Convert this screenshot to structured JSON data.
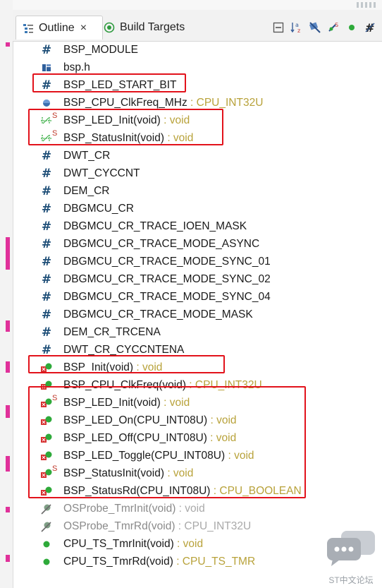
{
  "tabs": {
    "outline": {
      "label": "Outline",
      "close": "×"
    },
    "build_targets": {
      "label": "Build Targets"
    }
  },
  "toolbar_icons": [
    "collapse-all-icon",
    "sort-alphabetically-icon",
    "hide-fields-icon",
    "hide-static-members-icon",
    "hide-non-public-icon",
    "hide-macros-icon"
  ],
  "outline": {
    "items": [
      {
        "kind": "macro",
        "name": "BSP_MODULE",
        "type": ""
      },
      {
        "kind": "include",
        "name": "bsp.h",
        "type": ""
      },
      {
        "kind": "macro",
        "name": "BSP_LED_START_BIT",
        "type": ""
      },
      {
        "kind": "variable",
        "name": "BSP_CPU_ClkFreq_MHz",
        "type": " : CPU_INT32U"
      },
      {
        "kind": "proto-static",
        "name": "BSP_LED_Init(void)",
        "type": " : void",
        "static": "S"
      },
      {
        "kind": "proto-static",
        "name": "BSP_StatusInit(void)",
        "type": " : void",
        "static": "S"
      },
      {
        "kind": "macro",
        "name": "DWT_CR",
        "type": ""
      },
      {
        "kind": "macro",
        "name": "DWT_CYCCNT",
        "type": ""
      },
      {
        "kind": "macro",
        "name": "DEM_CR",
        "type": ""
      },
      {
        "kind": "macro",
        "name": "DBGMCU_CR",
        "type": ""
      },
      {
        "kind": "macro",
        "name": "DBGMCU_CR_TRACE_IOEN_MASK",
        "type": ""
      },
      {
        "kind": "macro",
        "name": "DBGMCU_CR_TRACE_MODE_ASYNC",
        "type": ""
      },
      {
        "kind": "macro",
        "name": "DBGMCU_CR_TRACE_MODE_SYNC_01",
        "type": ""
      },
      {
        "kind": "macro",
        "name": "DBGMCU_CR_TRACE_MODE_SYNC_02",
        "type": ""
      },
      {
        "kind": "macro",
        "name": "DBGMCU_CR_TRACE_MODE_SYNC_04",
        "type": ""
      },
      {
        "kind": "macro",
        "name": "DBGMCU_CR_TRACE_MODE_MASK",
        "type": ""
      },
      {
        "kind": "macro",
        "name": "DEM_CR_TRCENA",
        "type": ""
      },
      {
        "kind": "macro",
        "name": "DWT_CR_CYCCNTENA",
        "type": ""
      },
      {
        "kind": "function",
        "name": "BSP_Init(void)",
        "type": " : void"
      },
      {
        "kind": "function",
        "name": "BSP_CPU_ClkFreq(void)",
        "type": " : CPU_INT32U"
      },
      {
        "kind": "function-static",
        "name": "BSP_LED_Init(void)",
        "type": " : void",
        "static": "S"
      },
      {
        "kind": "function",
        "name": "BSP_LED_On(CPU_INT08U)",
        "type": " : void"
      },
      {
        "kind": "function",
        "name": "BSP_LED_Off(CPU_INT08U)",
        "type": " : void"
      },
      {
        "kind": "function",
        "name": "BSP_LED_Toggle(CPU_INT08U)",
        "type": " : void"
      },
      {
        "kind": "function-static",
        "name": "BSP_StatusInit(void)",
        "type": " : void",
        "static": "S"
      },
      {
        "kind": "function",
        "name": "BSP_StatusRd(CPU_INT08U)",
        "type": " : CPU_BOOLEAN"
      },
      {
        "kind": "function-disabled",
        "name": "OSProbe_TmrInit(void)",
        "type": " : void"
      },
      {
        "kind": "function-disabled",
        "name": "OSProbe_TmrRd(void)",
        "type": " : CPU_INT32U"
      },
      {
        "kind": "function-public",
        "name": "CPU_TS_TmrInit(void)",
        "type": " : void"
      },
      {
        "kind": "function-public",
        "name": "CPU_TS_TmrRd(void)",
        "type": " : CPU_TS_TMR"
      }
    ]
  },
  "watermark": {
    "label": "ST中文论坛"
  },
  "colors": {
    "highlight": "#e2121b",
    "type_text": "#b8a23a",
    "macro_icon": "#1f4f78",
    "public_fn": "#2eaa3a",
    "private_fn": "#d62f2f"
  }
}
